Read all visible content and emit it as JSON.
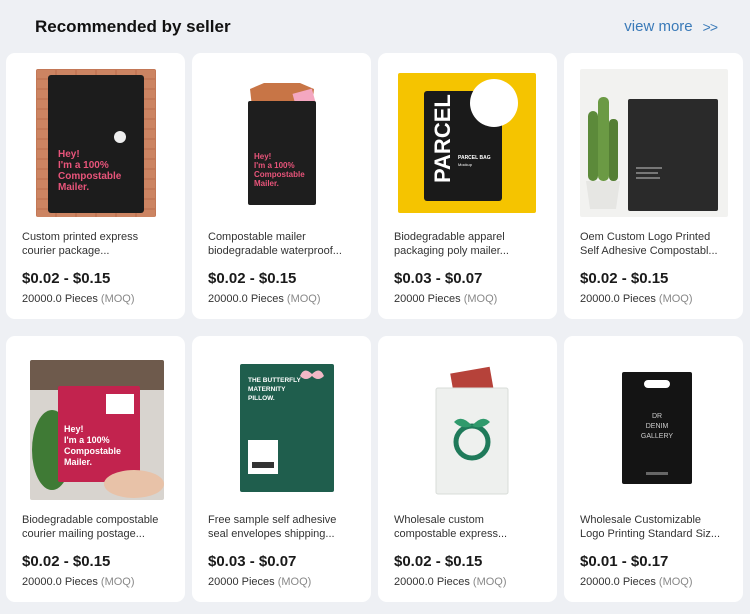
{
  "header": {
    "title": "Recommended by seller",
    "view_more": "view more",
    "view_more_icon": "double-chevron-right-icon"
  },
  "products": [
    {
      "name_line1": "Custom printed express",
      "name_line2": "courier package...",
      "price": "$0.02 - $0.15",
      "moq_qty": "20000.0 Pieces",
      "moq_tag": "(MOQ)",
      "image": "black-compostable-mailer-pink-text",
      "image_text": [
        "Hey!",
        "I'm a 100%",
        "Compostable",
        "Mailer."
      ]
    },
    {
      "name_line1": "Compostable mailer",
      "name_line2": "biodegradable waterproof...",
      "price": "$0.02 - $0.15",
      "moq_qty": "20000.0 Pieces",
      "moq_tag": "(MOQ)",
      "image": "black-mailer-with-tshirt",
      "image_text": [
        "Hey!",
        "I'm a 100%",
        "Compostable",
        "Mailer."
      ]
    },
    {
      "name_line1": "Biodegradable apparel",
      "name_line2": "packaging poly mailer...",
      "price": "$0.03 - $0.07",
      "moq_qty": "20000 Pieces",
      "moq_tag": "(MOQ)",
      "image": "parcel-bag-yellow-background",
      "image_text": [
        "PARCEL",
        "PARCEL BAG",
        "Mockup"
      ]
    },
    {
      "name_line1": "Oem Custom Logo Printed",
      "name_line2": "Self Adhesive Compostabl...",
      "price": "$0.02 - $0.15",
      "moq_qty": "20000.0 Pieces",
      "moq_tag": "(MOQ)",
      "image": "dark-mailer-with-cactus",
      "image_text": []
    },
    {
      "name_line1": "Biodegradable compostable",
      "name_line2": "courier mailing postage...",
      "price": "$0.02 - $0.15",
      "moq_qty": "20000.0 Pieces",
      "moq_tag": "(MOQ)",
      "image": "pink-mailer-held-in-hand",
      "image_text": [
        "Hey!",
        "I'm a 100%",
        "Compostable",
        "Mailer."
      ]
    },
    {
      "name_line1": "Free sample self adhesive",
      "name_line2": "seal envelopes shipping...",
      "price": "$0.03 - $0.07",
      "moq_qty": "20000 Pieces",
      "moq_tag": "(MOQ)",
      "image": "green-butterfly-maternity-mailer",
      "image_text": [
        "THE BUTTERFLY",
        "MATERNITY",
        "PILLOW."
      ]
    },
    {
      "name_line1": "Wholesale custom",
      "name_line2": "compostable express...",
      "price": "$0.02 - $0.15",
      "moq_qty": "20000.0 Pieces",
      "moq_tag": "(MOQ)",
      "image": "white-compostable-mailer-green-logo",
      "image_text": []
    },
    {
      "name_line1": "Wholesale Customizable",
      "name_line2": "Logo Printing Standard Siz...",
      "price": "$0.01 - $0.17",
      "moq_qty": "20000.0 Pieces",
      "moq_tag": "(MOQ)",
      "image": "black-dr-denim-gallery-bag",
      "image_text": [
        "DR",
        "DENIM",
        "GALLERY"
      ]
    }
  ],
  "colors": {
    "background": "#eef0f4",
    "card": "#ffffff",
    "link": "#3a7ab8",
    "moq_tag": "#888888",
    "pink_text": "#e8547a",
    "parcel_yellow": "#f5c400",
    "mailer_green": "#1f5e4d"
  }
}
